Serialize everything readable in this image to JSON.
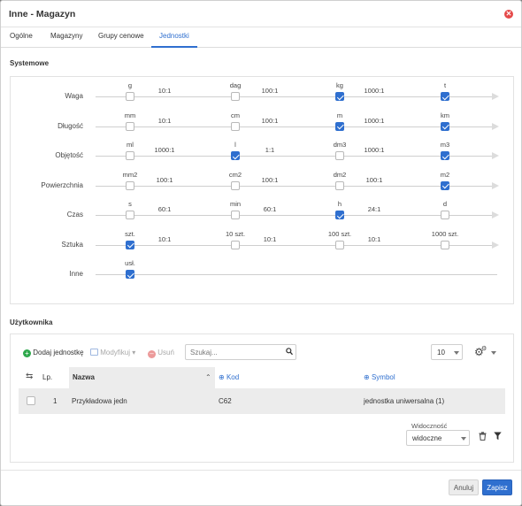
{
  "dialog": {
    "title": "Inne - Magazyn",
    "close_icon": "close-icon"
  },
  "tabs": [
    {
      "label": "Ogólne",
      "active": false
    },
    {
      "label": "Magazyny",
      "active": false
    },
    {
      "label": "Grupy cenowe",
      "active": false
    },
    {
      "label": "Jednostki",
      "active": true
    }
  ],
  "system": {
    "title": "Systemowe",
    "rows": [
      {
        "label": "Waga",
        "units": [
          {
            "symbol": "g",
            "checked": false
          },
          {
            "symbol": "dag",
            "checked": false
          },
          {
            "symbol": "kg",
            "checked": true
          },
          {
            "symbol": "t",
            "checked": true
          }
        ],
        "ratios": [
          "10:1",
          "100:1",
          "1000:1"
        ]
      },
      {
        "label": "Długość",
        "units": [
          {
            "symbol": "mm",
            "checked": false
          },
          {
            "symbol": "cm",
            "checked": false
          },
          {
            "symbol": "m",
            "checked": true
          },
          {
            "symbol": "km",
            "checked": true
          }
        ],
        "ratios": [
          "10:1",
          "100:1",
          "1000:1"
        ]
      },
      {
        "label": "Objętość",
        "units": [
          {
            "symbol": "ml",
            "checked": false
          },
          {
            "symbol": "l",
            "checked": true
          },
          {
            "symbol": "dm3",
            "checked": false
          },
          {
            "symbol": "m3",
            "checked": true
          }
        ],
        "ratios": [
          "1000:1",
          "1:1",
          "1000:1"
        ]
      },
      {
        "label": "Powierzchnia",
        "units": [
          {
            "symbol": "mm2",
            "checked": false
          },
          {
            "symbol": "cm2",
            "checked": false
          },
          {
            "symbol": "dm2",
            "checked": false
          },
          {
            "symbol": "m2",
            "checked": true
          }
        ],
        "ratios": [
          "100:1",
          "100:1",
          "100:1"
        ]
      },
      {
        "label": "Czas",
        "units": [
          {
            "symbol": "s",
            "checked": false
          },
          {
            "symbol": "min",
            "checked": false
          },
          {
            "symbol": "h",
            "checked": true
          },
          {
            "symbol": "d",
            "checked": false
          }
        ],
        "ratios": [
          "60:1",
          "60:1",
          "24:1"
        ]
      },
      {
        "label": "Sztuka",
        "units": [
          {
            "symbol": "szt.",
            "checked": true
          },
          {
            "symbol": "10 szt.",
            "checked": false
          },
          {
            "symbol": "100 szt.",
            "checked": false
          },
          {
            "symbol": "1000 szt.",
            "checked": false
          }
        ],
        "ratios": [
          "10:1",
          "10:1",
          "10:1"
        ]
      },
      {
        "label": "Inne",
        "units": [
          {
            "symbol": "usł.",
            "checked": true
          }
        ],
        "ratios": []
      }
    ]
  },
  "user": {
    "title": "Użytkownika",
    "toolbar": {
      "add_label": "Dodaj jednostkę",
      "modify_label": "Modyfikuj",
      "delete_label": "Usuń",
      "search_placeholder": "Szukaj...",
      "page_size": "10"
    },
    "grid": {
      "headers": {
        "lp": "Lp.",
        "name": "Nazwa",
        "code": "Kod",
        "symbol": "Symbol"
      },
      "rows": [
        {
          "lp": "1",
          "name": "Przykładowa jedn",
          "code": "C62",
          "symbol": "jednostka uniwersalna (1)"
        }
      ]
    },
    "visibility": {
      "label": "Widoczność",
      "value": "widoczne"
    }
  },
  "footer": {
    "cancel_label": "Anuluj",
    "save_label": "Zapisz"
  },
  "colors": {
    "accent": "#2f6fcf",
    "close": "#e54848",
    "add": "#2da84b",
    "delete": "#e57373"
  }
}
